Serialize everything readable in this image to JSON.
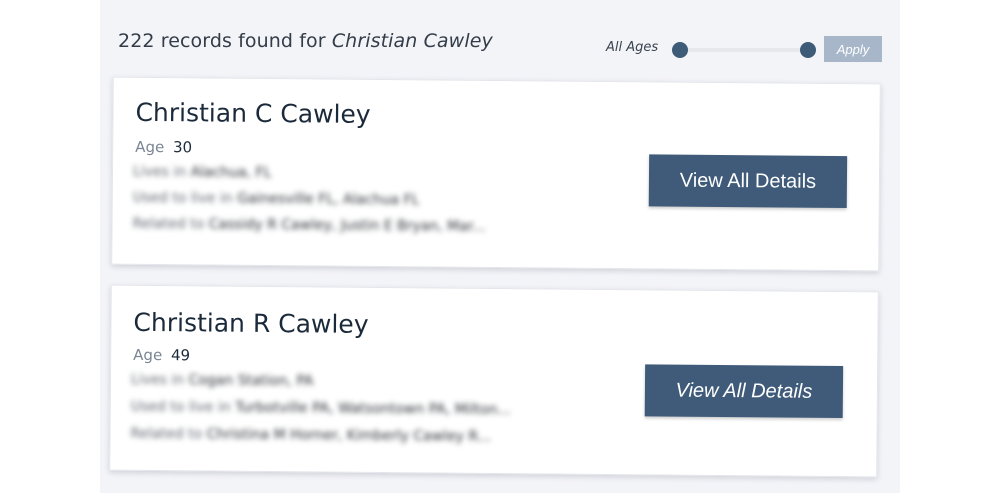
{
  "results": {
    "count_text": "222 records found for",
    "query": "Christian Cawley"
  },
  "filter": {
    "age_label": "All Ages",
    "apply_label": "Apply"
  },
  "people": [
    {
      "name": "Christian C Cawley",
      "age_key": "Age",
      "age": "30",
      "lived_in_key": "Lives in",
      "lived_in": "Alachua, FL",
      "used_to_live_key": "Used to live in",
      "used_to_live": "Gainesville FL, Alachua FL",
      "related_key": "Related to",
      "related": "Cassidy R Cawley, Justin E Bryan, Mar...",
      "button_label": "View All Details"
    },
    {
      "name": "Christian R Cawley",
      "age_key": "Age",
      "age": "49",
      "lived_in_key": "Lives in",
      "lived_in": "Cogan Station, PA",
      "used_to_live_key": "Used to live in",
      "used_to_live": "Turbotville PA, Watsontown PA, Milton...",
      "related_key": "Related to",
      "related": "Christina M Horner, Kimberly Cawley R...",
      "button_label": "View All Details"
    }
  ]
}
